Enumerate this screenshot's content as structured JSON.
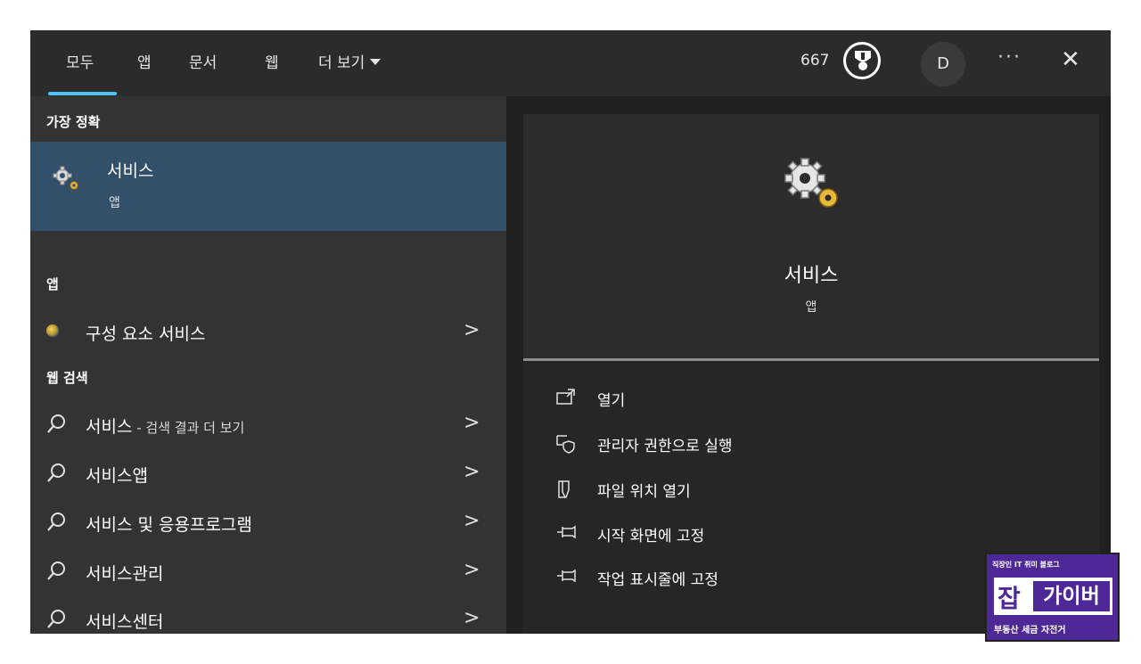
{
  "tabs": [
    {
      "label": "모두",
      "active": true
    },
    {
      "label": "앱"
    },
    {
      "label": "문서"
    },
    {
      "label": "웹"
    },
    {
      "label": "더 보기"
    }
  ],
  "header": {
    "points": "667",
    "avatar_initial": "D",
    "more_label": "···",
    "close_label": "✕",
    "accent": "#4cc2ff"
  },
  "left": {
    "best_match_heading": "가장 정확",
    "best_match": {
      "title": "서비스",
      "subtitle": "앱",
      "icon": "gears-icon",
      "highlight": "#32506a"
    },
    "apps_heading": "앱",
    "apps": [
      {
        "label": "구성 요소 서비스",
        "icon": "component-services-icon"
      }
    ],
    "web_heading": "웹 검색",
    "web_results": [
      {
        "bold": "서비스",
        "suffix": " - 검색 결과 더 보기"
      },
      {
        "bold": "서비스앱",
        "suffix": ""
      },
      {
        "bold": "서비스 및 응용프로그램",
        "suffix": ""
      },
      {
        "bold": "서비스관리",
        "suffix": ""
      },
      {
        "bold": "서비스센터",
        "suffix": ""
      }
    ]
  },
  "preview": {
    "title": "서비스",
    "subtitle": "앱",
    "actions": [
      {
        "label": "열기",
        "icon": "open-icon"
      },
      {
        "label": "관리자 권한으로 실행",
        "icon": "shield-icon"
      },
      {
        "label": "파일 위치 열기",
        "icon": "file-location-icon"
      },
      {
        "label": "시작 화면에 고정",
        "icon": "pin-icon"
      },
      {
        "label": "작업 표시줄에 고정",
        "icon": "pin-icon"
      }
    ]
  },
  "watermark": {
    "tagline": "직장인 IT 취미 블로그",
    "logo_mark": "잡",
    "logo_text": "가이버",
    "footer": "부동산 세금 자전거",
    "color": "#4e2896"
  }
}
